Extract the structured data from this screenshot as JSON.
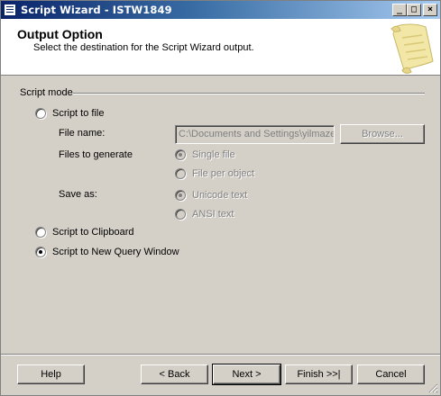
{
  "window": {
    "title": "Script Wizard - ISTW1849",
    "minimize_glyph": "_",
    "maximize_glyph": "□",
    "close_glyph": "×"
  },
  "header": {
    "title": "Output Option",
    "subtitle": "Select the destination for the Script Wizard output."
  },
  "script_mode": {
    "group_label": "Script mode",
    "script_to_file": {
      "label": "Script to file",
      "selected": false
    },
    "file_name": {
      "label": "File name:",
      "value": "C:\\Documents and Settings\\yilmaze",
      "browse_label": "Browse..."
    },
    "files_to_generate": {
      "label": "Files to generate",
      "options": [
        {
          "label": "Single file",
          "selected": true
        },
        {
          "label": "File per object",
          "selected": false
        }
      ]
    },
    "save_as": {
      "label": "Save as:",
      "options": [
        {
          "label": "Unicode text",
          "selected": true
        },
        {
          "label": "ANSI text",
          "selected": false
        }
      ]
    },
    "script_to_clipboard": {
      "label": "Script to Clipboard",
      "selected": false
    },
    "script_to_new_query_window": {
      "label": "Script to New Query Window",
      "selected": true
    }
  },
  "footer": {
    "help_label": "Help",
    "back_label": "< Back",
    "next_label": "Next >",
    "finish_label": "Finish >>|",
    "cancel_label": "Cancel"
  },
  "colors": {
    "dialog_bg": "#d4d0c8",
    "title_start": "#0a246a",
    "title_end": "#a6caf0",
    "disabled_text": "#808080"
  }
}
